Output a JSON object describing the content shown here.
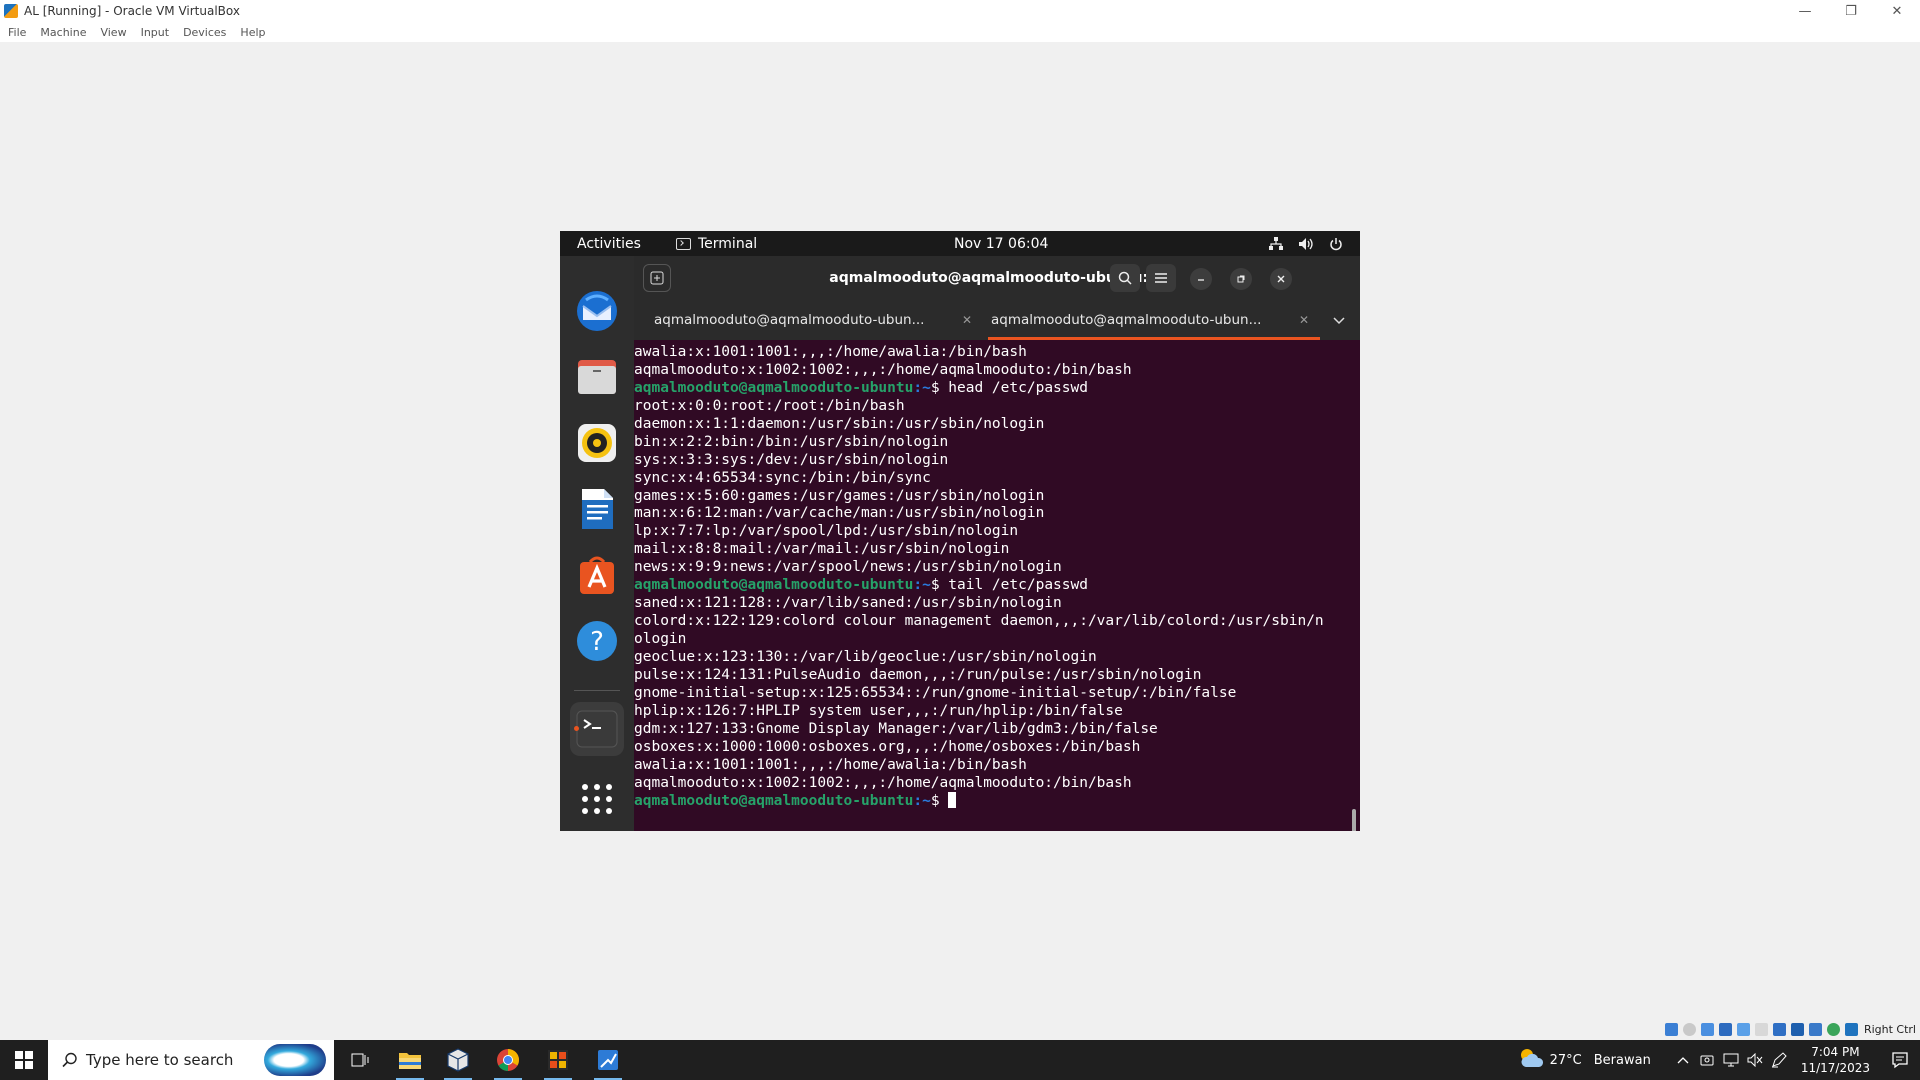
{
  "host_window": {
    "title": "AL [Running] - Oracle VM VirtualBox",
    "menu": [
      "File",
      "Machine",
      "View",
      "Input",
      "Devices",
      "Help"
    ],
    "controls": {
      "minimize": "—",
      "restore": "❐",
      "close": "✕"
    }
  },
  "guest": {
    "topbar": {
      "activities": "Activities",
      "app_name": "Terminal",
      "clock": "Nov 17  06:04",
      "status_icons": [
        "network-icon",
        "volume-icon",
        "power-icon"
      ]
    },
    "dock": {
      "items": [
        "thunderbird-icon",
        "files-icon",
        "rhythmbox-icon",
        "libreoffice-writer-icon",
        "app-center-icon",
        "help-icon",
        "terminal-icon",
        "show-apps-icon"
      ]
    },
    "terminal": {
      "title": "aqmalmooduto@aqmalmooduto-ubuntu: ~",
      "tabs": [
        {
          "label": "aqmalmooduto@aqmalmooduto-ubun...",
          "active": false
        },
        {
          "label": "aqmalmooduto@aqmalmooduto-ubun...",
          "active": true
        }
      ],
      "prompt_user": "aqmalmooduto@aqmalmooduto-ubuntu",
      "prompt_path": ":~",
      "prompt_symbol": "$",
      "lines": [
        {
          "type": "out",
          "text": "awalia:x:1001:1001:,,,:/home/awalia:/bin/bash"
        },
        {
          "type": "out",
          "text": "aqmalmooduto:x:1002:1002:,,,:/home/aqmalmooduto:/bin/bash"
        },
        {
          "type": "cmd",
          "text": " head /etc/passwd"
        },
        {
          "type": "out",
          "text": "root:x:0:0:root:/root:/bin/bash"
        },
        {
          "type": "out",
          "text": "daemon:x:1:1:daemon:/usr/sbin:/usr/sbin/nologin"
        },
        {
          "type": "out",
          "text": "bin:x:2:2:bin:/bin:/usr/sbin/nologin"
        },
        {
          "type": "out",
          "text": "sys:x:3:3:sys:/dev:/usr/sbin/nologin"
        },
        {
          "type": "out",
          "text": "sync:x:4:65534:sync:/bin:/bin/sync"
        },
        {
          "type": "out",
          "text": "games:x:5:60:games:/usr/games:/usr/sbin/nologin"
        },
        {
          "type": "out",
          "text": "man:x:6:12:man:/var/cache/man:/usr/sbin/nologin"
        },
        {
          "type": "out",
          "text": "lp:x:7:7:lp:/var/spool/lpd:/usr/sbin/nologin"
        },
        {
          "type": "out",
          "text": "mail:x:8:8:mail:/var/mail:/usr/sbin/nologin"
        },
        {
          "type": "out",
          "text": "news:x:9:9:news:/var/spool/news:/usr/sbin/nologin"
        },
        {
          "type": "cmd",
          "text": " tail /etc/passwd"
        },
        {
          "type": "out",
          "text": "saned:x:121:128::/var/lib/saned:/usr/sbin/nologin"
        },
        {
          "type": "out",
          "text": "colord:x:122:129:colord colour management daemon,,,:/var/lib/colord:/usr/sbin/n"
        },
        {
          "type": "out",
          "text": "ologin"
        },
        {
          "type": "out",
          "text": "geoclue:x:123:130::/var/lib/geoclue:/usr/sbin/nologin"
        },
        {
          "type": "out",
          "text": "pulse:x:124:131:PulseAudio daemon,,,:/run/pulse:/usr/sbin/nologin"
        },
        {
          "type": "out",
          "text": "gnome-initial-setup:x:125:65534::/run/gnome-initial-setup/:/bin/false"
        },
        {
          "type": "out",
          "text": "hplip:x:126:7:HPLIP system user,,,:/run/hplip:/bin/false"
        },
        {
          "type": "out",
          "text": "gdm:x:127:133:Gnome Display Manager:/var/lib/gdm3:/bin/false"
        },
        {
          "type": "out",
          "text": "osboxes:x:1000:1000:osboxes.org,,,:/home/osboxes:/bin/bash"
        },
        {
          "type": "out",
          "text": "awalia:x:1001:1001:,,,:/home/awalia:/bin/bash"
        },
        {
          "type": "out",
          "text": "aqmalmooduto:x:1002:1002:,,,:/home/aqmalmooduto:/bin/bash"
        },
        {
          "type": "cursor",
          "text": " "
        }
      ]
    }
  },
  "vbox_status": {
    "host_key": "Right Ctrl"
  },
  "taskbar": {
    "search_placeholder": "Type here to search",
    "apps": [
      "task-view-icon",
      "file-explorer-icon",
      "virtualbox-icon",
      "chrome-icon",
      "git-icon",
      "snip-icon"
    ],
    "weather_temp": "27°C",
    "weather_desc": "Berawan",
    "time": "7:04 PM",
    "date": "11/17/2023"
  }
}
